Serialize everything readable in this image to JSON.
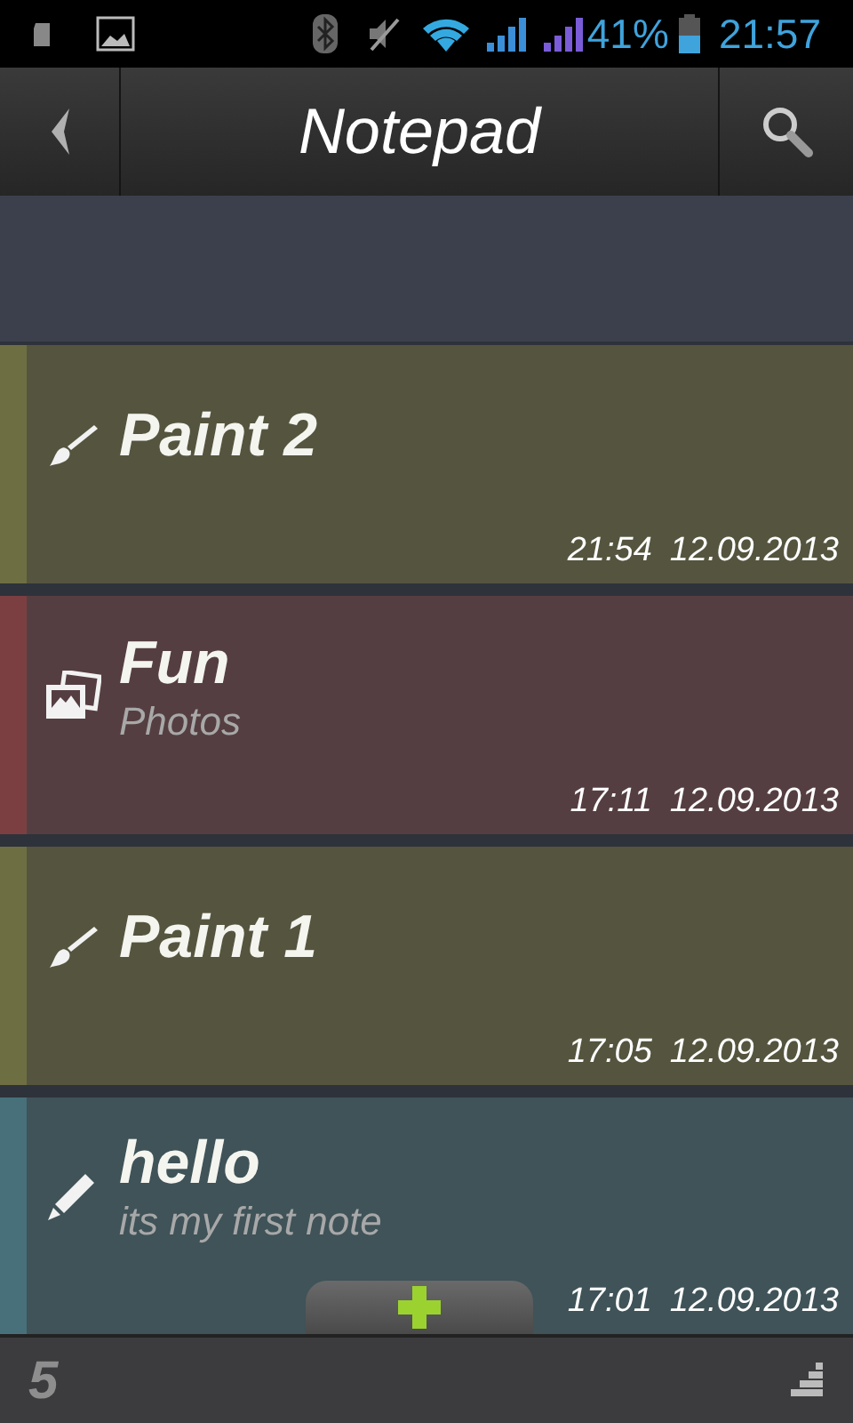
{
  "status_bar": {
    "battery_percent": "41%",
    "clock": "21:57"
  },
  "toolbar": {
    "title": "Notepad"
  },
  "notes": [
    {
      "kind": "paint",
      "title": "Paint 2",
      "time": "21:54",
      "date": "12.09.2013",
      "color": "#6d6f42"
    },
    {
      "kind": "photos",
      "title": "Fun",
      "subtitle": "Photos",
      "time": "17:11",
      "date": "12.09.2013",
      "color": "#7b3f42"
    },
    {
      "kind": "paint",
      "title": "Paint 1",
      "time": "17:05",
      "date": "12.09.2013",
      "color": "#6d6f42"
    },
    {
      "kind": "text",
      "title": "hello",
      "subtitle": "its my first note",
      "time": "17:01",
      "date": "12.09.2013",
      "color": "#47707a"
    }
  ],
  "bottom_bar": {
    "count": "5"
  }
}
